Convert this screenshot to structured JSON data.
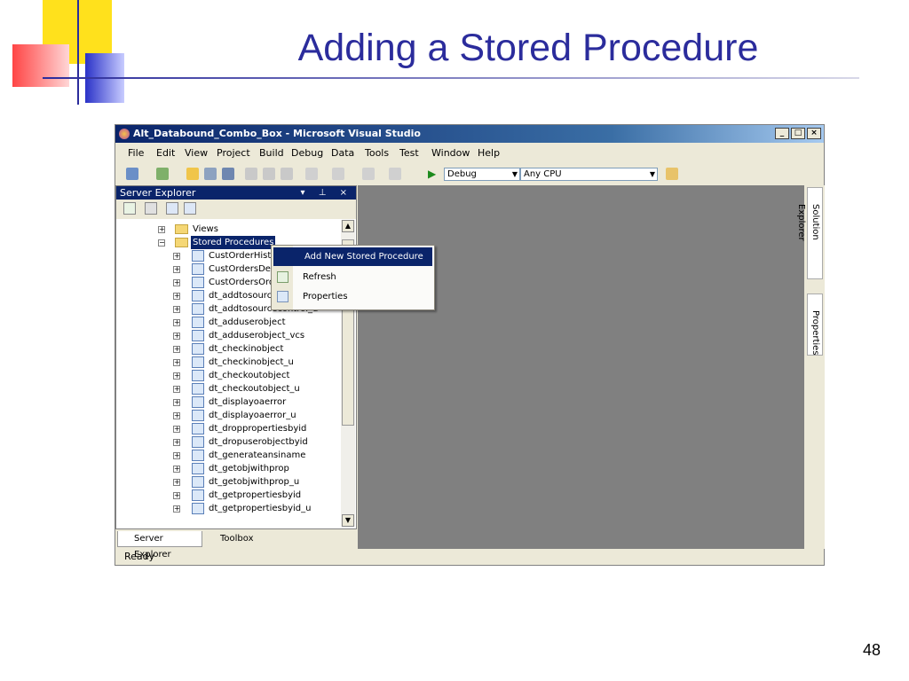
{
  "slide": {
    "title": "Adding a Stored Procedure",
    "page_number": "48"
  },
  "window": {
    "title": "Alt_Databound_Combo_Box - Microsoft Visual Studio",
    "controls": [
      "_",
      "□",
      "×"
    ]
  },
  "menubar": [
    "File",
    "Edit",
    "View",
    "Project",
    "Build",
    "Debug",
    "Data",
    "Tools",
    "Test",
    "Window",
    "Help"
  ],
  "toolbar": {
    "config": "Debug",
    "platform": "Any CPU"
  },
  "server_explorer": {
    "title": "Server Explorer",
    "controls": "▾ ⊥ ×",
    "folders": [
      {
        "label": "Views",
        "expanded": false
      },
      {
        "label": "Stored Procedures",
        "expanded": true,
        "selected": true
      }
    ],
    "procedures": [
      "CustOrderHist",
      "CustOrdersDet",
      "CustOrdersOrd",
      "dt_addtosourc",
      "dt_addtosourcecontrol_u",
      "dt_adduserobject",
      "dt_adduserobject_vcs",
      "dt_checkinobject",
      "dt_checkinobject_u",
      "dt_checkoutobject",
      "dt_checkoutobject_u",
      "dt_displayoaerror",
      "dt_displayoaerror_u",
      "dt_droppropertiesbyid",
      "dt_dropuserobjectbyid",
      "dt_generateansiname",
      "dt_getobjwithprop",
      "dt_getobjwithprop_u",
      "dt_getpropertiesbyid",
      "dt_getpropertiesbyid_u"
    ],
    "tabs": [
      "Server Explorer",
      "Toolbox"
    ]
  },
  "context_menu": {
    "items": [
      {
        "label": "Add New Stored Procedure",
        "selected": true,
        "icon": "none"
      },
      {
        "label": "Refresh",
        "icon": "refresh-icon"
      },
      {
        "label": "Properties",
        "icon": "properties-icon"
      }
    ]
  },
  "right_tabs": [
    "Solution Explorer",
    "Properties"
  ],
  "status": "Ready"
}
